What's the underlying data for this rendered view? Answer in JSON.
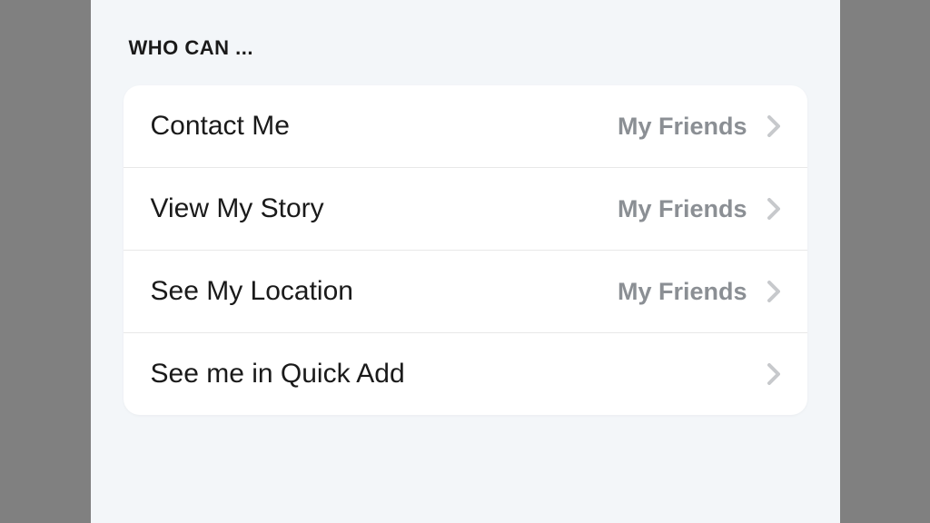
{
  "section": {
    "title": "WHO CAN ..."
  },
  "rows": [
    {
      "label": "Contact Me",
      "value": "My Friends"
    },
    {
      "label": "View My Story",
      "value": "My Friends"
    },
    {
      "label": "See My Location",
      "value": "My Friends"
    },
    {
      "label": "See me in Quick Add",
      "value": ""
    }
  ]
}
